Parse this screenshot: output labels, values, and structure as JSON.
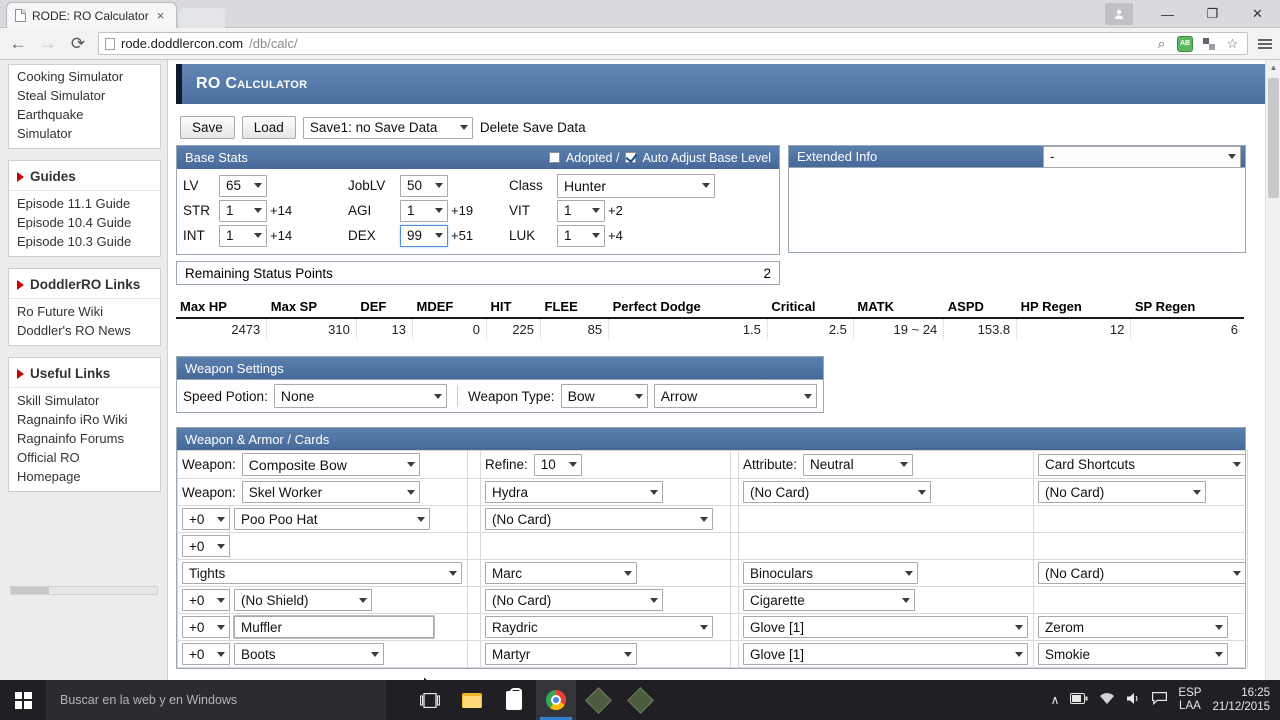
{
  "browser": {
    "tab_title": "RODE: RO Calculator",
    "tab_close": "×",
    "url_host": "rode.doddlercon.com",
    "url_path": "/db/calc/",
    "minimize": "—",
    "maximize": "❐",
    "close": "✕",
    "back": "←",
    "forward": "→",
    "reload": "⟳",
    "zoom_icon": "⌕",
    "adblock_label": "AB",
    "bookmark_icon": "☆",
    "user_icon": "●"
  },
  "sidebar": {
    "sim_links": [
      "Cooking Simulator",
      "Steal Simulator",
      "Earthquake",
      "Simulator"
    ],
    "sections": [
      {
        "title": "Guides",
        "links": [
          "Episode 11.1 Guide",
          "Episode 10.4 Guide",
          "Episode 10.3 Guide"
        ]
      },
      {
        "title": "DoddlerRO Links",
        "links": [
          "Ro Future Wiki",
          "Doddler's RO News"
        ]
      },
      {
        "title": "Useful Links",
        "links": [
          "Skill Simulator",
          "Ragnainfo iRo Wiki",
          "Ragnainfo Forums",
          "Official RO",
          "Homepage"
        ]
      }
    ]
  },
  "page": {
    "banner_title": "RO Calculator",
    "save_row": {
      "save": "Save",
      "load": "Load",
      "slot": "Save1: no Save Data",
      "delete": "Delete Save Data"
    },
    "base_stats": {
      "title": "Base Stats",
      "adopted_label": "Adopted /",
      "adopted_checked": false,
      "auto_adjust_label": "Auto Adjust Base Level",
      "auto_adjust_checked": true,
      "rows": [
        {
          "l1": "LV",
          "v1": "65",
          "b1": "",
          "l2": "JobLV",
          "v2": "50",
          "b2": "",
          "l3": "Class",
          "v3": "Hunter",
          "b3": ""
        },
        {
          "l1": "STR",
          "v1": "1",
          "b1": "+14",
          "l2": "AGI",
          "v2": "1",
          "b2": "+19",
          "l3": "VIT",
          "v3": "1",
          "b3": "+2"
        },
        {
          "l1": "INT",
          "v1": "1",
          "b1": "+14",
          "l2": "DEX",
          "v2": "99",
          "b2": "+51",
          "l3": "LUK",
          "v3": "1",
          "b3": "+4"
        }
      ],
      "remaining_label": "Remaining Status Points",
      "remaining_value": "2"
    },
    "extended_info": {
      "title": "Extended Info",
      "selected": "-"
    },
    "stat_table": {
      "headers": [
        "Max HP",
        "Max SP",
        "DEF",
        "MDEF",
        "HIT",
        "FLEE",
        "Perfect Dodge",
        "Critical",
        "MATK",
        "ASPD",
        "HP Regen",
        "SP Regen"
      ],
      "values": [
        "2473",
        "310",
        "13",
        "0",
        "225",
        "85",
        "1.5",
        "2.5",
        "19 ~ 24",
        "153.8",
        "12",
        "6"
      ]
    },
    "weapon_settings": {
      "title": "Weapon Settings",
      "speed_potion_label": "Speed Potion:",
      "speed_potion": "None",
      "weapon_type_label": "Weapon Type:",
      "weapon_type": "Bow",
      "ammo": "Arrow"
    },
    "weapon_armor": {
      "title": "Weapon & Armor / Cards",
      "weapon_label": "Weapon:",
      "refine_label": "Refine:",
      "attribute_label": "Attribute:",
      "rows": [
        {
          "refine": "",
          "item_label": "Weapon:",
          "item": "Composite Bow",
          "mid_label": "Refine:",
          "mid": "10",
          "right_label": "Attribute:",
          "right": "Neutral",
          "far": "Card Shortcuts"
        },
        {
          "refine": "",
          "item_label": "Weapon:",
          "item": "Skel Worker",
          "mid_label": "",
          "mid": "Hydra",
          "right_label": "",
          "right": "(No Card)",
          "far": "(No Card)"
        },
        {
          "refine": "+0",
          "item_label": "",
          "item": "Poo Poo Hat",
          "mid_label": "",
          "mid": "(No Card)",
          "right_label": "",
          "right": "",
          "far": ""
        },
        {
          "refine": "+0",
          "item_label": "",
          "item": "",
          "mid_label": "",
          "mid": "",
          "right_label": "",
          "right": "",
          "far": ""
        },
        {
          "refine": "",
          "item_label": "",
          "item": "Tights",
          "mid_label": "",
          "mid": "Marc",
          "right_label": "",
          "right": "Binoculars",
          "far": "(No Card)"
        },
        {
          "refine": "+0",
          "item_label": "",
          "item": "(No Shield)",
          "mid_label": "",
          "mid": "(No Card)",
          "right_label": "",
          "right": "Cigarette",
          "far": ""
        },
        {
          "refine": "+0",
          "item_label": "",
          "item": "Muffler",
          "mid_label": "",
          "mid": "Raydric",
          "right_label": "",
          "right": "Glove [1]",
          "far": "Zerom"
        },
        {
          "refine": "+0",
          "item_label": "",
          "item": "Boots",
          "mid_label": "",
          "mid": "Martyr",
          "right_label": "",
          "right": "Glove [1]",
          "far": "Smokie"
        }
      ]
    }
  },
  "taskbar": {
    "search_placeholder": "Buscar en la web y en Windows",
    "language": "ESP",
    "keyboard": "LAA",
    "time": "16:25",
    "date": "21/12/2015",
    "chevron": "∧",
    "battery": "▬",
    "wifi": "◔",
    "volume": "🔊",
    "action_center": "▤"
  }
}
